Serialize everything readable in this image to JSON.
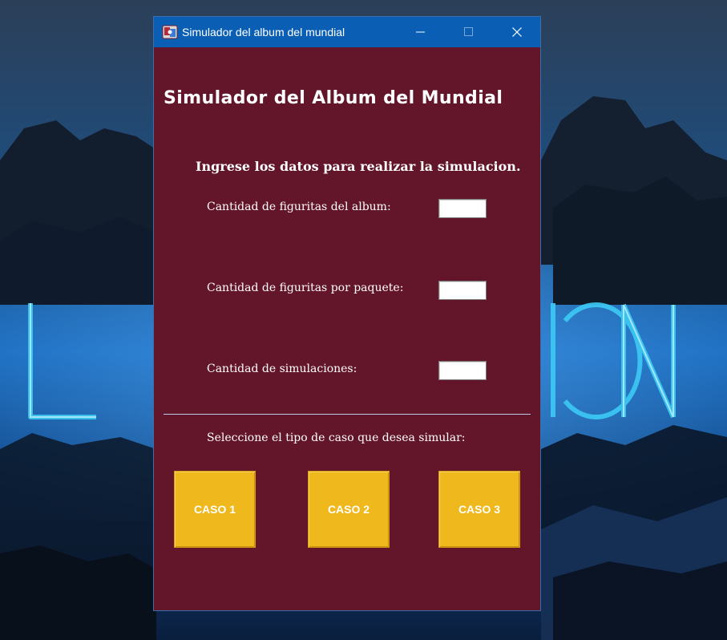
{
  "desktop": {
    "wallpaper_text": "LEÓN",
    "colors": {
      "sky": "#0d2e55",
      "mist": "#1e6fc0",
      "glow": "#39c4f2",
      "rock": "#0c1624"
    }
  },
  "window": {
    "title": "Simulador del album del mundial",
    "icon": "app-icon",
    "controls": {
      "minimize": "minimize-icon",
      "maximize": "maximize-icon",
      "close": "close-icon"
    },
    "colors": {
      "titlebar": "#0a5fb4",
      "body": "#63152a",
      "button": "#efb81c"
    }
  },
  "form": {
    "heading": "Simulador del Album del Mundial",
    "subheading": "Ingrese los datos para realizar la simulacion.",
    "fields": [
      {
        "label": "Cantidad de figuritas del album:",
        "value": ""
      },
      {
        "label": "Cantidad de figuritas por paquete:",
        "value": ""
      },
      {
        "label": "Cantidad de simulaciones:",
        "value": ""
      }
    ],
    "select_label": "Seleccione el tipo de caso que desea simular:",
    "buttons": [
      "CASO 1",
      "CASO 2",
      "CASO 3"
    ]
  }
}
